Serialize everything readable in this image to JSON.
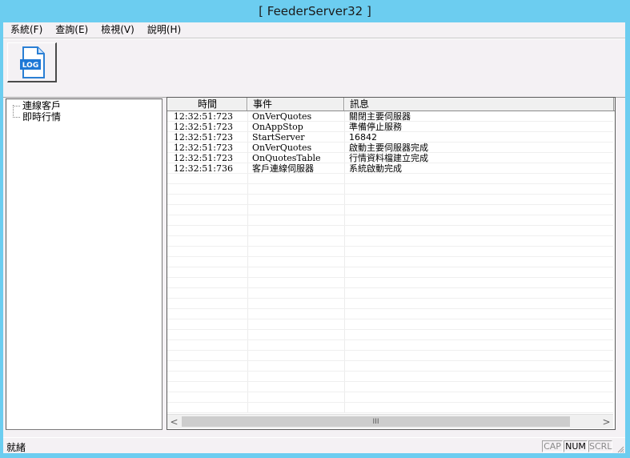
{
  "window": {
    "title": "[ FeederServer32 ]"
  },
  "menu": [
    {
      "label": "系統(F)"
    },
    {
      "label": "查詢(E)"
    },
    {
      "label": "檢視(V)"
    },
    {
      "label": "說明(H)"
    }
  ],
  "toolbar": {
    "log_button_label": "LOG",
    "log_icon": "log-file-icon"
  },
  "tree": {
    "items": [
      {
        "label": "連線客戶"
      },
      {
        "label": "即時行情"
      }
    ]
  },
  "list": {
    "columns": [
      "時間",
      "事件",
      "訊息"
    ],
    "rows": [
      {
        "time": "12:32:51:723",
        "event": "OnVerQuotes",
        "message": "關閉主要伺服器"
      },
      {
        "time": "12:32:51:723",
        "event": "OnAppStop",
        "message": "準備停止服務"
      },
      {
        "time": "12:32:51:723",
        "event": "StartServer",
        "message": "16842"
      },
      {
        "time": "12:32:51:723",
        "event": "OnVerQuotes",
        "message": "啟動主要伺服器完成"
      },
      {
        "time": "12:32:51:723",
        "event": "OnQuotesTable",
        "message": "行情資料檔建立完成"
      },
      {
        "time": "12:32:51:736",
        "event": "客戶連線伺服器",
        "message": "系統啟動完成"
      }
    ],
    "scroll_left": "<",
    "scroll_right": ">",
    "scroll_thumb_grip": "III"
  },
  "status": {
    "text": "就緒",
    "indicators": [
      {
        "label": "CAP",
        "active": false
      },
      {
        "label": "NUM",
        "active": true
      },
      {
        "label": "SCRL",
        "active": false
      }
    ]
  }
}
